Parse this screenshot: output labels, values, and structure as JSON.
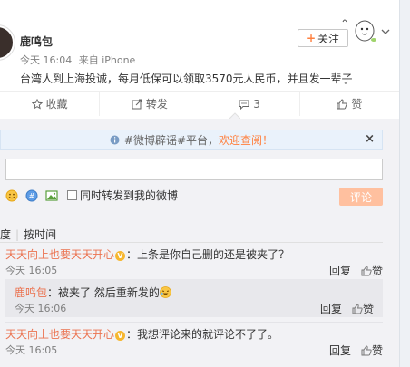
{
  "post": {
    "author": "鹿鸣包",
    "time": "今天 16:04",
    "source": "来自 iPhone",
    "text": "台湾人到上海投诚，每月低保可以领取3570元人民币，并且发一辈子",
    "follow_label": "关注",
    "follow_plus": "+"
  },
  "actions": [
    {
      "label": "收藏",
      "icon": "star-icon"
    },
    {
      "label": "转发",
      "icon": "forward-icon"
    },
    {
      "label": "3",
      "icon": "comment-icon"
    },
    {
      "label": "赞",
      "icon": "thumbs-up-icon"
    }
  ],
  "notice": {
    "prefix": "#微博辟谣#平台，",
    "highlight": "欢迎查阅！",
    "close": "×"
  },
  "comment_form": {
    "input_value": "",
    "sync_label": "同时转发到我的微博",
    "submit_label": "评论",
    "tools": [
      "emoji-icon",
      "topic-icon",
      "image-icon"
    ]
  },
  "sort": {
    "by_hot": "度",
    "separator": "|",
    "by_time": "按时间"
  },
  "comments": [
    {
      "user": "天天向上也要天天开心",
      "badge": "V",
      "text": "：上条是你自己删的还是被夹了？",
      "time": "今天 16:05",
      "reply_label": "回复",
      "like_label": "赞"
    },
    {
      "user": "天天向上也要天天开心",
      "badge": "V",
      "text": "：我想评论来的就评论不了了。",
      "time": "今天 16:05",
      "reply_label": "回复",
      "like_label": "赞"
    }
  ],
  "reply": {
    "user": "鹿鸣包",
    "text": "：被夹了 然后重新发的",
    "time": "今天 16:06",
    "reply_label": "回复",
    "like_label": "赞"
  },
  "colors": {
    "accent": "#ff8140",
    "username": "#eb7350",
    "submit_disabled": "#ffc09f",
    "notice_bg": "#eaf2fb"
  }
}
